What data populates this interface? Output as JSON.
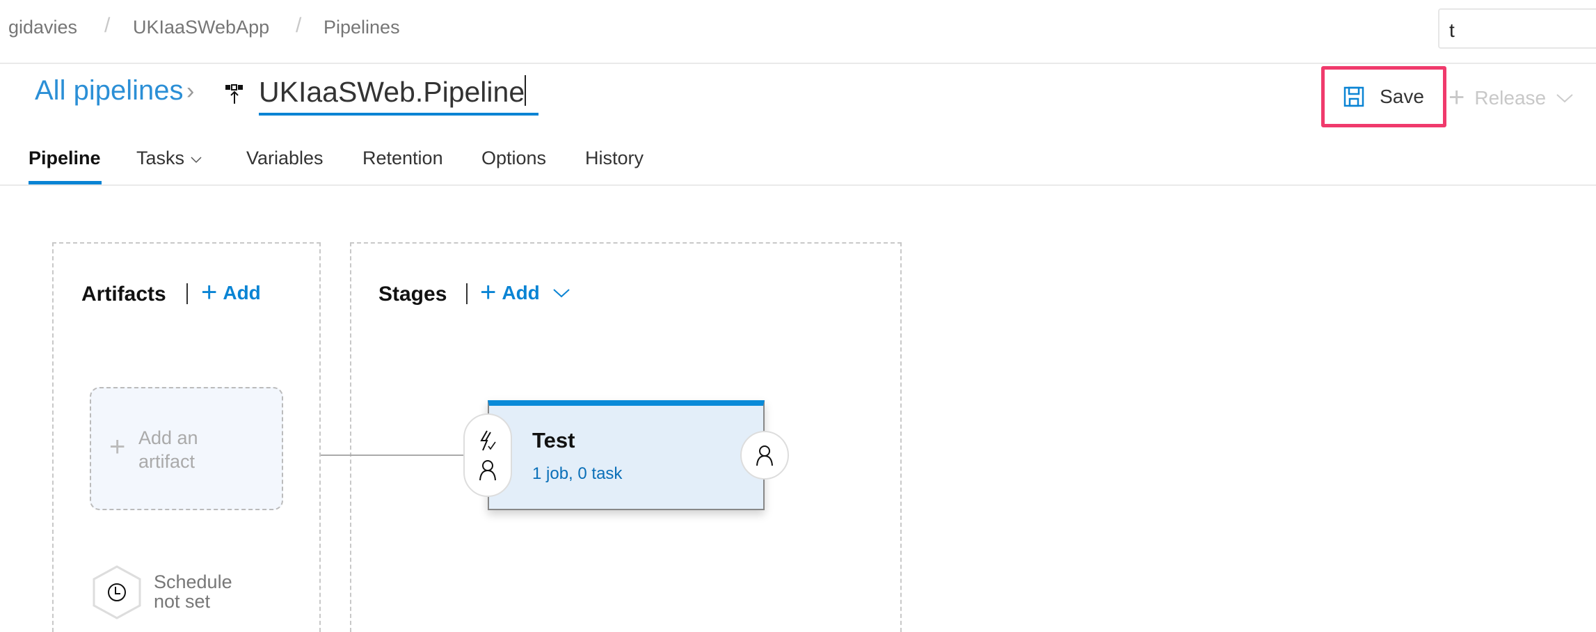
{
  "breadcrumb": [
    "gidavies",
    "UKIaaSWebApp",
    "Pipelines"
  ],
  "search": {
    "value": "t"
  },
  "header": {
    "all_pipelines": "All pipelines",
    "title": "UKIaaSWeb.Pipeline",
    "save": "Save",
    "release": "Release"
  },
  "tabs": [
    "Pipeline",
    "Tasks",
    "Variables",
    "Retention",
    "Options",
    "History"
  ],
  "artifacts": {
    "heading": "Artifacts",
    "add": "Add",
    "add_artifact_line1": "Add an",
    "add_artifact_line2": "artifact",
    "schedule_line1": "Schedule",
    "schedule_line2": "not set"
  },
  "stages": {
    "heading": "Stages",
    "add": "Add",
    "stage": {
      "name": "Test",
      "summary": "1 job, 0 task"
    }
  },
  "colors": {
    "accent": "#0a84d4",
    "highlight": "#f03a6c",
    "stage_bg": "#e3eef9"
  }
}
